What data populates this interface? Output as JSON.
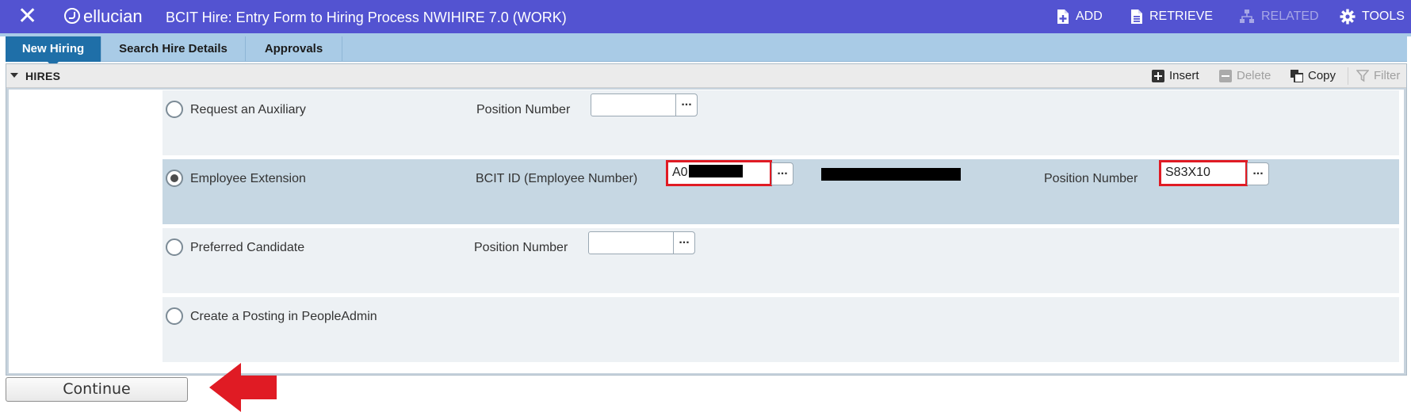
{
  "header": {
    "close_glyph": "✕",
    "brand": "ellucian",
    "title": "BCIT Hire: Entry Form to Hiring Process NWIHIRE 7.0 (WORK)",
    "actions": [
      {
        "label": "ADD",
        "icon": "add-page-icon",
        "enabled": true
      },
      {
        "label": "RETRIEVE",
        "icon": "retrieve-page-icon",
        "enabled": true
      },
      {
        "label": "RELATED",
        "icon": "related-sitemap-icon",
        "enabled": false
      },
      {
        "label": "TOOLS",
        "icon": "gear-icon",
        "enabled": true
      }
    ],
    "color": "#5353d1"
  },
  "tabs": [
    {
      "label": "New Hiring",
      "active": true
    },
    {
      "label": "Search Hire Details",
      "active": false
    },
    {
      "label": "Approvals",
      "active": false
    }
  ],
  "section": {
    "title": "HIRES",
    "toolbar": [
      {
        "label": "Insert",
        "icon": "plus-square-icon",
        "enabled": true
      },
      {
        "label": "Delete",
        "icon": "minus-square-icon",
        "enabled": false
      },
      {
        "label": "Copy",
        "icon": "copy-icon",
        "enabled": true
      },
      {
        "label": "Filter",
        "icon": "filter-icon",
        "enabled": false
      }
    ]
  },
  "options": [
    {
      "label": "Request an Auxiliary",
      "selected": false,
      "fields": [
        {
          "label": "Position Number",
          "value": ""
        }
      ]
    },
    {
      "label": "Employee Extension",
      "selected": true,
      "fields": [
        {
          "label": "BCIT ID (Employee Number)",
          "value": "A0",
          "redacted": true,
          "highlighted": true
        },
        {
          "label": "Position Number",
          "value": "S83X10",
          "highlighted": true
        }
      ],
      "employee_name_redacted": true
    },
    {
      "label": "Preferred Candidate",
      "selected": false,
      "fields": [
        {
          "label": "Position Number",
          "value": ""
        }
      ]
    },
    {
      "label": "Create a Posting in PeopleAdmin",
      "selected": false,
      "fields": []
    }
  ],
  "lookup_button_glyph": "...",
  "continue_label": "Continue",
  "annotation": {
    "type": "arrow",
    "color": "#e01b24",
    "points_to": "continue-button"
  }
}
